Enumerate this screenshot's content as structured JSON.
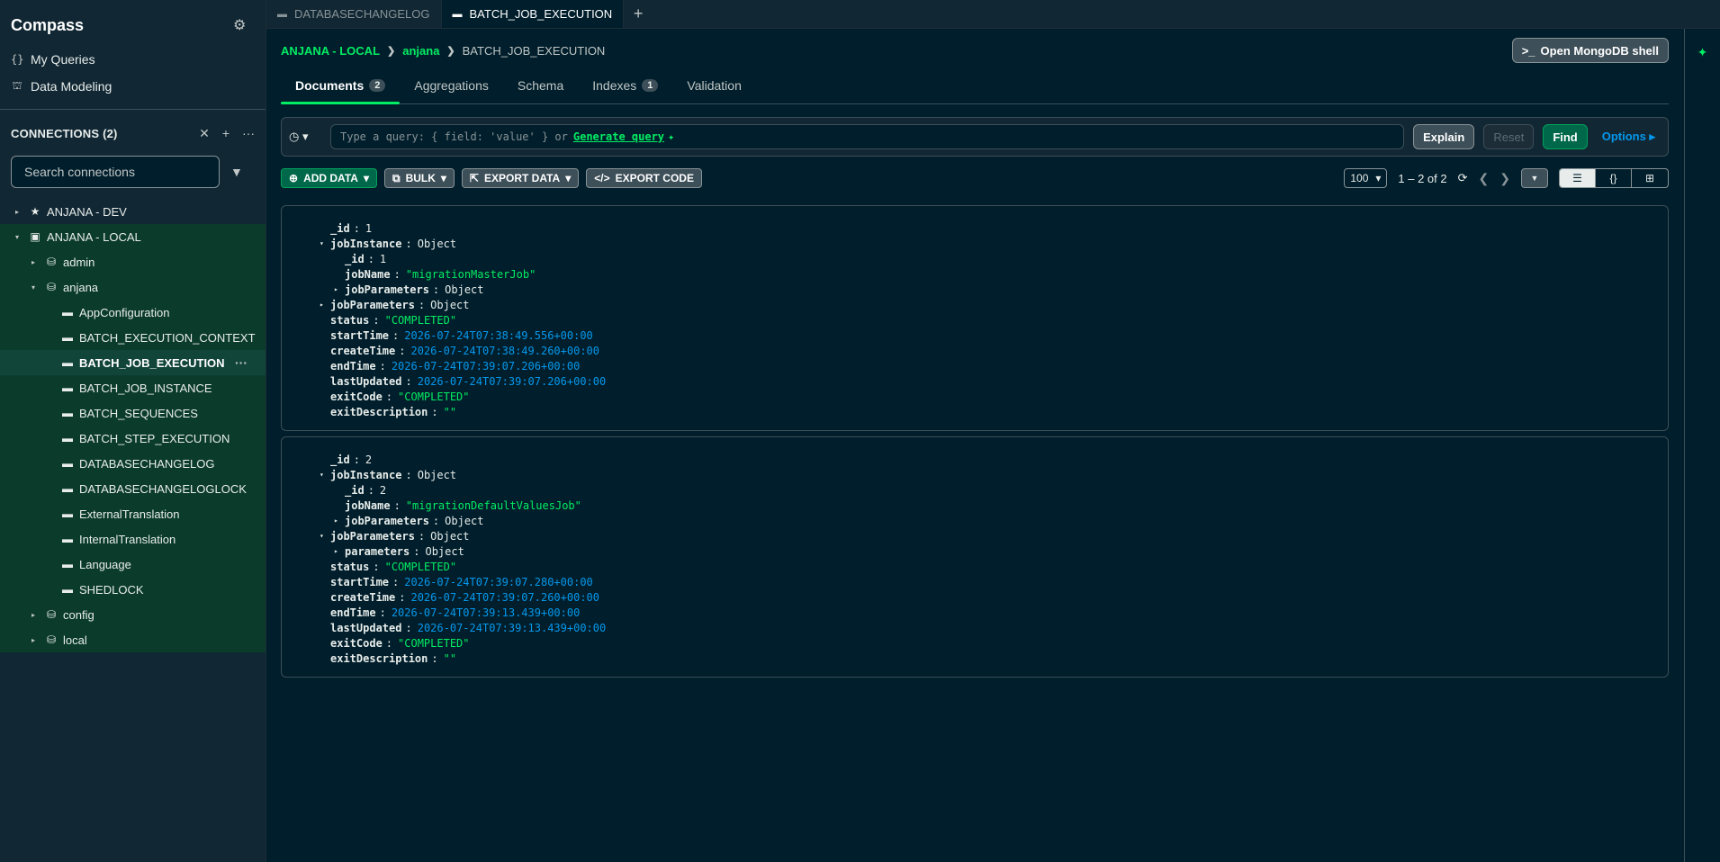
{
  "sidebar": {
    "title": "Compass",
    "nav": [
      {
        "icon": "{}",
        "label": "My Queries"
      },
      {
        "icon": "⛫",
        "label": "Data Modeling"
      }
    ],
    "connections_title": "CONNECTIONS (2)",
    "search_placeholder": "Search connections",
    "tree": [
      {
        "level": 0,
        "caret": "▸",
        "icon": "★",
        "label": "ANJANA - DEV",
        "green": false,
        "selected": false
      },
      {
        "level": 0,
        "caret": "▾",
        "icon": "▣",
        "label": "ANJANA - LOCAL",
        "green": true,
        "selected": false
      },
      {
        "level": 1,
        "caret": "▸",
        "icon": "⛁",
        "label": "admin",
        "green": true,
        "selected": false
      },
      {
        "level": 1,
        "caret": "▾",
        "icon": "⛁",
        "label": "anjana",
        "green": true,
        "selected": false
      },
      {
        "level": 2,
        "caret": "",
        "icon": "▬",
        "label": "AppConfiguration",
        "green": true,
        "selected": false
      },
      {
        "level": 2,
        "caret": "",
        "icon": "▬",
        "label": "BATCH_EXECUTION_CONTEXT",
        "green": true,
        "selected": false
      },
      {
        "level": 2,
        "caret": "",
        "icon": "▬",
        "label": "BATCH_JOB_EXECUTION",
        "green": true,
        "selected": true
      },
      {
        "level": 2,
        "caret": "",
        "icon": "▬",
        "label": "BATCH_JOB_INSTANCE",
        "green": true,
        "selected": false
      },
      {
        "level": 2,
        "caret": "",
        "icon": "▬",
        "label": "BATCH_SEQUENCES",
        "green": true,
        "selected": false
      },
      {
        "level": 2,
        "caret": "",
        "icon": "▬",
        "label": "BATCH_STEP_EXECUTION",
        "green": true,
        "selected": false
      },
      {
        "level": 2,
        "caret": "",
        "icon": "▬",
        "label": "DATABASECHANGELOG",
        "green": true,
        "selected": false
      },
      {
        "level": 2,
        "caret": "",
        "icon": "▬",
        "label": "DATABASECHANGELOGLOCK",
        "green": true,
        "selected": false
      },
      {
        "level": 2,
        "caret": "",
        "icon": "▬",
        "label": "ExternalTranslation",
        "green": true,
        "selected": false
      },
      {
        "level": 2,
        "caret": "",
        "icon": "▬",
        "label": "InternalTranslation",
        "green": true,
        "selected": false
      },
      {
        "level": 2,
        "caret": "",
        "icon": "▬",
        "label": "Language",
        "green": true,
        "selected": false
      },
      {
        "level": 2,
        "caret": "",
        "icon": "▬",
        "label": "SHEDLOCK",
        "green": true,
        "selected": false
      },
      {
        "level": 1,
        "caret": "▸",
        "icon": "⛁",
        "label": "config",
        "green": true,
        "selected": false
      },
      {
        "level": 1,
        "caret": "▸",
        "icon": "⛁",
        "label": "local",
        "green": true,
        "selected": false
      }
    ]
  },
  "tabs": [
    {
      "label": "DATABASECHANGELOG",
      "active": false
    },
    {
      "label": "BATCH_JOB_EXECUTION",
      "active": true
    }
  ],
  "breadcrumb": {
    "connection": "ANJANA - LOCAL",
    "database": "anjana",
    "collection": "BATCH_JOB_EXECUTION"
  },
  "shell_button": "Open MongoDB shell",
  "subtabs": [
    {
      "label": "Documents",
      "count": "2",
      "active": true
    },
    {
      "label": "Aggregations",
      "count": "",
      "active": false
    },
    {
      "label": "Schema",
      "count": "",
      "active": false
    },
    {
      "label": "Indexes",
      "count": "1",
      "active": false
    },
    {
      "label": "Validation",
      "count": "",
      "active": false
    }
  ],
  "query": {
    "placeholder": "Type a query: { field: 'value' } or",
    "generate": "Generate query",
    "explain": "Explain",
    "reset": "Reset",
    "find": "Find",
    "options": "Options"
  },
  "toolbar": {
    "add_data": "ADD DATA",
    "bulk": "BULK",
    "export_data": "EXPORT DATA",
    "export_code": "EXPORT CODE",
    "page_size": "100",
    "range": "1 – 2 of 2"
  },
  "documents": [
    {
      "fields": [
        {
          "level": 0,
          "toggle": "",
          "key": "_id",
          "value": "1",
          "type": "num"
        },
        {
          "level": 0,
          "toggle": "▾",
          "key": "jobInstance",
          "value": "Object",
          "type": "obj"
        },
        {
          "level": 1,
          "toggle": "",
          "key": "_id",
          "value": "1",
          "type": "num"
        },
        {
          "level": 1,
          "toggle": "",
          "key": "jobName",
          "value": "\"migrationMasterJob\"",
          "type": "str"
        },
        {
          "level": 1,
          "toggle": "▸",
          "key": "jobParameters",
          "value": "Object",
          "type": "obj"
        },
        {
          "level": 0,
          "toggle": "▸",
          "key": "jobParameters",
          "value": "Object",
          "type": "obj"
        },
        {
          "level": 0,
          "toggle": "",
          "key": "status",
          "value": "\"COMPLETED\"",
          "type": "str"
        },
        {
          "level": 0,
          "toggle": "",
          "key": "startTime",
          "value": "2026-07-24T07:38:49.556+00:00",
          "type": "date"
        },
        {
          "level": 0,
          "toggle": "",
          "key": "createTime",
          "value": "2026-07-24T07:38:49.260+00:00",
          "type": "date"
        },
        {
          "level": 0,
          "toggle": "",
          "key": "endTime",
          "value": "2026-07-24T07:39:07.206+00:00",
          "type": "date"
        },
        {
          "level": 0,
          "toggle": "",
          "key": "lastUpdated",
          "value": "2026-07-24T07:39:07.206+00:00",
          "type": "date"
        },
        {
          "level": 0,
          "toggle": "",
          "key": "exitCode",
          "value": "\"COMPLETED\"",
          "type": "str"
        },
        {
          "level": 0,
          "toggle": "",
          "key": "exitDescription",
          "value": "\"\"",
          "type": "str"
        }
      ]
    },
    {
      "fields": [
        {
          "level": 0,
          "toggle": "",
          "key": "_id",
          "value": "2",
          "type": "num"
        },
        {
          "level": 0,
          "toggle": "▾",
          "key": "jobInstance",
          "value": "Object",
          "type": "obj"
        },
        {
          "level": 1,
          "toggle": "",
          "key": "_id",
          "value": "2",
          "type": "num"
        },
        {
          "level": 1,
          "toggle": "",
          "key": "jobName",
          "value": "\"migrationDefaultValuesJob\"",
          "type": "str"
        },
        {
          "level": 1,
          "toggle": "▸",
          "key": "jobParameters",
          "value": "Object",
          "type": "obj"
        },
        {
          "level": 0,
          "toggle": "▾",
          "key": "jobParameters",
          "value": "Object",
          "type": "obj"
        },
        {
          "level": 1,
          "toggle": "▸",
          "key": "parameters",
          "value": "Object",
          "type": "obj"
        },
        {
          "level": 0,
          "toggle": "",
          "key": "status",
          "value": "\"COMPLETED\"",
          "type": "str"
        },
        {
          "level": 0,
          "toggle": "",
          "key": "startTime",
          "value": "2026-07-24T07:39:07.280+00:00",
          "type": "date"
        },
        {
          "level": 0,
          "toggle": "",
          "key": "createTime",
          "value": "2026-07-24T07:39:07.260+00:00",
          "type": "date"
        },
        {
          "level": 0,
          "toggle": "",
          "key": "endTime",
          "value": "2026-07-24T07:39:13.439+00:00",
          "type": "date"
        },
        {
          "level": 0,
          "toggle": "",
          "key": "lastUpdated",
          "value": "2026-07-24T07:39:13.439+00:00",
          "type": "date"
        },
        {
          "level": 0,
          "toggle": "",
          "key": "exitCode",
          "value": "\"COMPLETED\"",
          "type": "str"
        },
        {
          "level": 0,
          "toggle": "",
          "key": "exitDescription",
          "value": "\"\"",
          "type": "str"
        }
      ]
    }
  ],
  "colors": {
    "accent": "#00ed64",
    "bg": "#001e2b",
    "date": "#0498ec"
  }
}
